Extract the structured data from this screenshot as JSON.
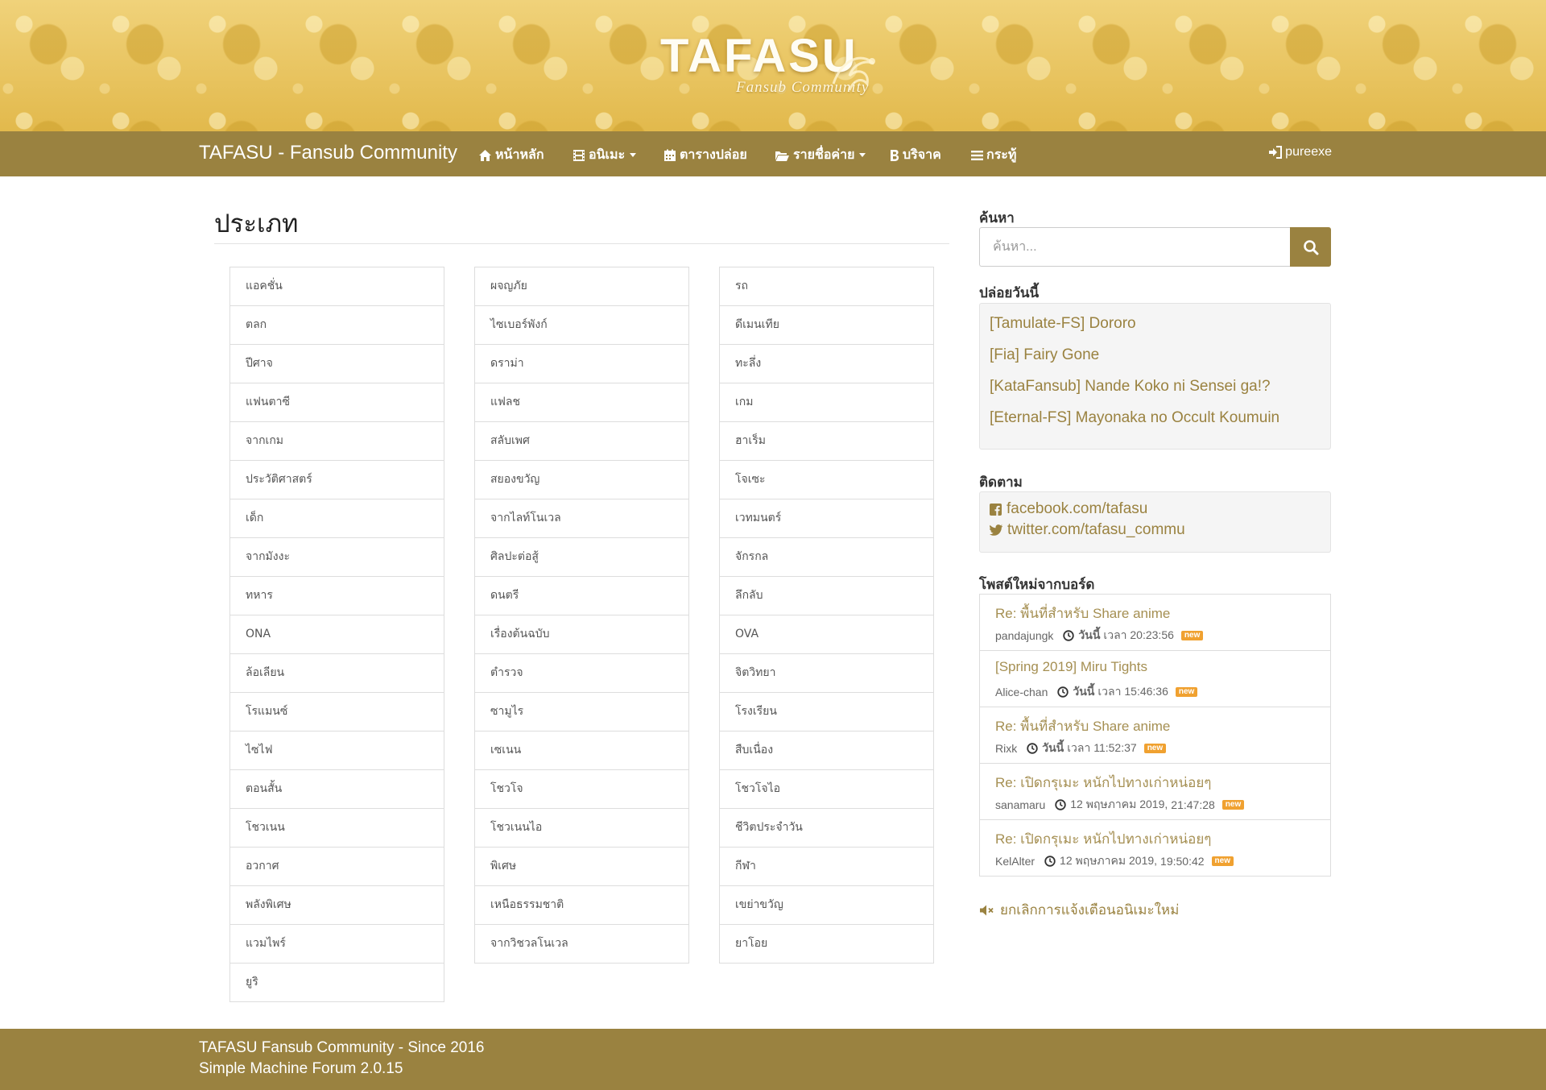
{
  "header": {
    "logo_main": "TAFASU",
    "logo_sub": "Fansub Community"
  },
  "nav": {
    "brand": "TAFASU - Fansub Community",
    "items": [
      {
        "label": "หน้าหลัก",
        "icon": "home-icon"
      },
      {
        "label": "อนิเมะ",
        "icon": "film-icon",
        "dropdown": true
      },
      {
        "label": "ตารางปล่อย",
        "icon": "calendar-icon"
      },
      {
        "label": "รายชื่อค่าย",
        "icon": "folder-open-icon",
        "dropdown": true
      },
      {
        "label": "บริจาค",
        "icon": "bitcoin-icon"
      },
      {
        "label": "กระทู้",
        "icon": "list-icon"
      }
    ],
    "user": "pureexe"
  },
  "main": {
    "title": "ประเภท",
    "columns": [
      [
        "แอคชั่น",
        "ตลก",
        "ปีศาจ",
        "แฟนตาซี",
        "จากเกม",
        "ประวัติศาสตร์",
        "เด็ก",
        "จากมังงะ",
        "ทหาร",
        "ONA",
        "ล้อเลียน",
        "โรแมนซ์",
        "ไซไฟ",
        "ตอนสั้น",
        "โชวเนน",
        "อวกาศ",
        "พลังพิเศษ",
        "แวมไพร์",
        "ยูริ"
      ],
      [
        "ผจญภัย",
        "ไซเบอร์พังก์",
        "ดราม่า",
        "แฟลช",
        "สลับเพศ",
        "สยองขวัญ",
        "จากไลท์โนเวล",
        "ศิลปะต่อสู้",
        "ดนตรี",
        "เรื่องต้นฉบับ",
        "ตำรวจ",
        "ซามูไร",
        "เซเนน",
        "โชวโจ",
        "โชวเนนไอ",
        "พิเศษ",
        "เหนือธรรมชาติ",
        "จากวิชวลโนเวล"
      ],
      [
        "รถ",
        "ดีเมนเทีย",
        "ทะลึ่ง",
        "เกม",
        "ฮาเร็ม",
        "โจเซะ",
        "เวทมนตร์",
        "จักรกล",
        "ลึกลับ",
        "OVA",
        "จิตวิทยา",
        "โรงเรียน",
        "สืบเนื่อง",
        "โชวโจไอ",
        "ชีวิตประจำวัน",
        "กีฬา",
        "เขย่าขวัญ",
        "ยาโอย"
      ]
    ]
  },
  "sidebar": {
    "search_heading": "ค้นหา",
    "search_placeholder": "ค้นหา...",
    "today_heading": "ปล่อยวันนี้",
    "today": [
      "[Tamulate-FS] Dororo",
      "[Fia] Fairy Gone",
      "[KataFansub] Nande Koko ni Sensei ga!?",
      "[Eternal-FS] Mayonaka no Occult Koumuin"
    ],
    "follow_heading": "ติดตาม",
    "follow": [
      {
        "label": "facebook.com/tafasu",
        "icon": "facebook-icon"
      },
      {
        "label": "twitter.com/tafasu_commu",
        "icon": "twitter-icon"
      }
    ],
    "posts_heading": "โพสต์ใหม่จากบอร์ด",
    "posts": [
      {
        "title": "Re: พื้นที่สำหรับ Share anime",
        "author": "pandajungk",
        "day": "วันนี้",
        "time": "เวลา 20:23:56",
        "badge": "new"
      },
      {
        "title": "[Spring 2019] Miru Tights",
        "author": "Alice-chan",
        "day": "วันนี้",
        "time": "เวลา 15:46:36",
        "badge": "new"
      },
      {
        "title": "Re: พื้นที่สำหรับ Share anime",
        "author": "Rixk",
        "day": "วันนี้",
        "time": "เวลา 11:52:37",
        "badge": "new"
      },
      {
        "title": "Re: เปิดกรุเมะ หนักไปทางเก่าหน่อยๆ",
        "author": "sanamaru",
        "day": "12 พฤษภาคม 2019,",
        "time": "21:47:28",
        "badge": "new"
      },
      {
        "title": "Re: เปิดกรุเมะ หนักไปทางเก่าหน่อยๆ",
        "author": "KelAlter",
        "day": "12 พฤษภาคม 2019,",
        "time": "19:50:42",
        "badge": "new"
      }
    ],
    "mute_label": "ยกเลิกการแจ้งเตือนอนิเมะใหม่"
  },
  "footer": {
    "line1": "TAFASU Fansub Community - Since 2016",
    "line2": "Simple Machine Forum 2.0.15"
  },
  "colors": {
    "navbar": "#9a8240",
    "link": "#9a8240",
    "badge": "#f0a130",
    "banner": "#e8c55a"
  }
}
